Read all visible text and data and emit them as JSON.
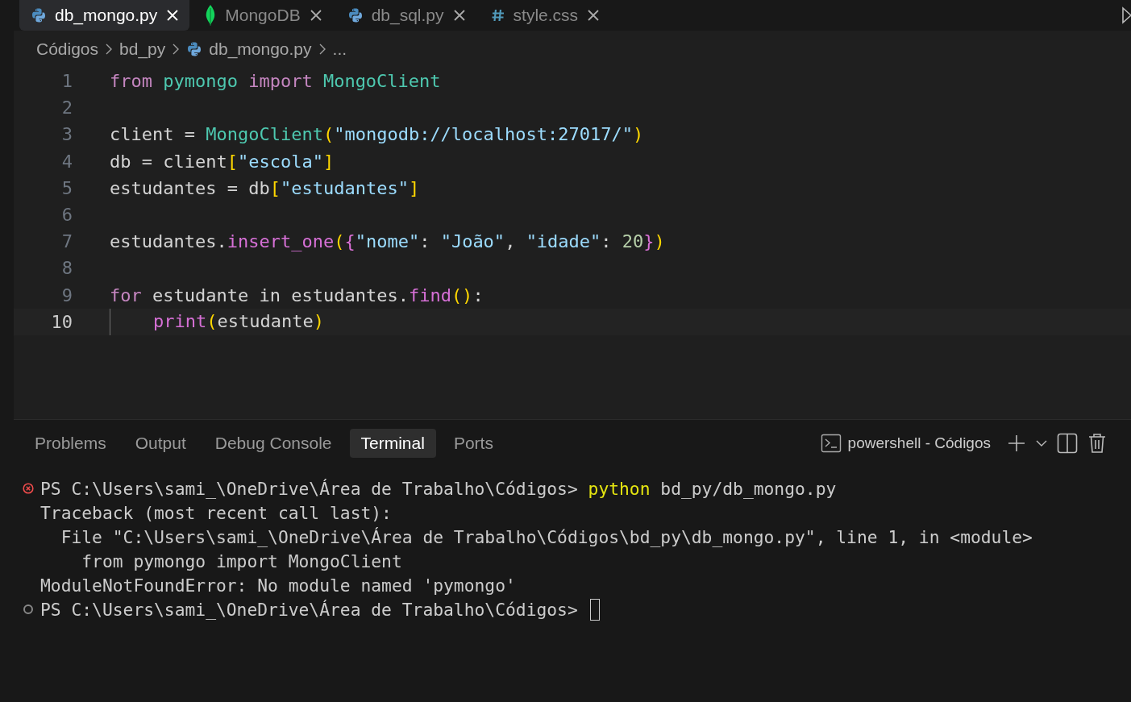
{
  "tabs": [
    {
      "label": "db_mongo.py",
      "kind": "python",
      "selected": true
    },
    {
      "label": "MongoDB",
      "kind": "mongodb",
      "selected": false
    },
    {
      "label": "db_sql.py",
      "kind": "python",
      "selected": false
    },
    {
      "label": "style.css",
      "kind": "css",
      "selected": false
    }
  ],
  "breadcrumb": [
    {
      "label": "Códigos",
      "kind": "folder"
    },
    {
      "label": "bd_py",
      "kind": "folder"
    },
    {
      "label": "db_mongo.py",
      "kind": "python"
    },
    {
      "label": "...",
      "kind": "symbol"
    }
  ],
  "editor": {
    "lines": [
      {
        "number": "1",
        "current": false,
        "tokens": [
          {
            "kind": "keyword",
            "text": "from"
          },
          {
            "kind": "space"
          },
          {
            "kind": "type",
            "text": "pymongo"
          },
          {
            "kind": "space"
          },
          {
            "kind": "keyword",
            "text": "import"
          },
          {
            "kind": "space"
          },
          {
            "kind": "type",
            "text": "MongoClient"
          }
        ]
      },
      {
        "number": "2",
        "current": false
      },
      {
        "number": "3",
        "current": false,
        "tokens": [
          {
            "kind": "plain",
            "text": "client = "
          },
          {
            "kind": "type",
            "text": "MongoClient"
          },
          {
            "kind": "brace1",
            "text": "("
          },
          {
            "kind": "string",
            "text": "\"mongodb://localhost:27017/\""
          },
          {
            "kind": "brace1",
            "text": ")"
          }
        ]
      },
      {
        "number": "4",
        "current": false,
        "tokens": [
          {
            "kind": "plain",
            "text": "db = client"
          },
          {
            "kind": "brace1",
            "text": "["
          },
          {
            "kind": "string",
            "text": "\"escola\""
          },
          {
            "kind": "brace1",
            "text": "]"
          }
        ]
      },
      {
        "number": "5",
        "current": false,
        "tokens": [
          {
            "kind": "plain",
            "text": "estudantes = db"
          },
          {
            "kind": "brace1",
            "text": "["
          },
          {
            "kind": "string",
            "text": "\"estudantes\""
          },
          {
            "kind": "brace1",
            "text": "]"
          }
        ]
      },
      {
        "number": "6",
        "current": false
      },
      {
        "number": "7",
        "current": false,
        "tokens": [
          {
            "kind": "plain",
            "text": "estudantes."
          },
          {
            "kind": "func",
            "text": "insert_one"
          },
          {
            "kind": "brace1",
            "text": "("
          },
          {
            "kind": "brace2",
            "text": "{"
          },
          {
            "kind": "string",
            "text": "\"nome\""
          },
          {
            "kind": "plain",
            "text": ": "
          },
          {
            "kind": "string",
            "text": "\"João\""
          },
          {
            "kind": "plain",
            "text": ", "
          },
          {
            "kind": "string",
            "text": "\"idade\""
          },
          {
            "kind": "plain",
            "text": ": "
          },
          {
            "kind": "number",
            "text": "20"
          },
          {
            "kind": "brace2",
            "text": "}"
          },
          {
            "kind": "brace1",
            "text": ")"
          }
        ]
      },
      {
        "number": "8",
        "current": false
      },
      {
        "number": "9",
        "current": false,
        "tokens": [
          {
            "kind": "keyword",
            "text": "for"
          },
          {
            "kind": "plain",
            "text": " estudante in estudantes."
          },
          {
            "kind": "func",
            "text": "find"
          },
          {
            "kind": "brace1",
            "text": "()"
          },
          {
            "kind": "plain",
            "text": ":"
          }
        ]
      },
      {
        "number": "10",
        "current": true,
        "tokens": [
          {
            "kind": "indent"
          },
          {
            "kind": "func",
            "text": "print"
          },
          {
            "kind": "brace1",
            "text": "("
          },
          {
            "kind": "plain",
            "text": "estudante"
          },
          {
            "kind": "brace1",
            "text": ")"
          }
        ]
      }
    ]
  },
  "panel": {
    "tabs": [
      {
        "label": "Problems",
        "selected": false
      },
      {
        "label": "Output",
        "selected": false
      },
      {
        "label": "Debug Console",
        "selected": false
      },
      {
        "label": "Terminal",
        "selected": true
      },
      {
        "label": "Ports",
        "selected": false
      }
    ],
    "terminal_name": "powershell - Códigos",
    "terminal": [
      {
        "kind": "failed_command",
        "segments": [
          {
            "kind": "plain",
            "text": "PS C:\\Users\\sami_\\OneDrive\\Área de Trabalho\\Códigos> "
          },
          {
            "kind": "command",
            "text": "python"
          },
          {
            "kind": "plain",
            "text": " bd_py/db_mongo.py"
          }
        ]
      },
      {
        "kind": "output",
        "segments": [
          {
            "kind": "plain",
            "text": "Traceback (most recent call last):"
          }
        ]
      },
      {
        "kind": "output",
        "segments": [
          {
            "kind": "plain",
            "text": "  File \"C:\\Users\\sami_\\OneDrive\\Área de Trabalho\\Códigos\\bd_py\\db_mongo.py\", line 1, in <module>"
          }
        ]
      },
      {
        "kind": "output",
        "segments": [
          {
            "kind": "plain",
            "text": "    from pymongo import MongoClient"
          }
        ]
      },
      {
        "kind": "output",
        "segments": [
          {
            "kind": "plain",
            "text": "ModuleNotFoundError: No module named 'pymongo'"
          }
        ]
      },
      {
        "kind": "prompt",
        "segments": [
          {
            "kind": "plain",
            "text": "PS C:\\Users\\sami_\\OneDrive\\Área de Trabalho\\Códigos> "
          },
          {
            "kind": "cursor"
          }
        ]
      }
    ]
  }
}
